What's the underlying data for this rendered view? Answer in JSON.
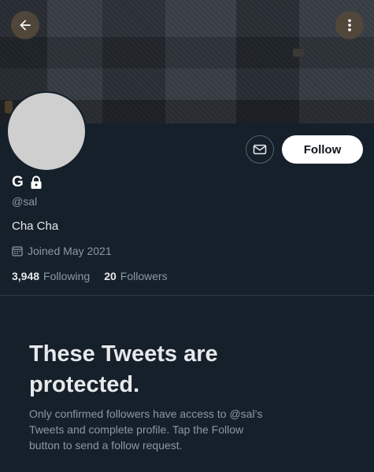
{
  "header": {
    "back_icon": "arrow-left-icon",
    "more_icon": "more-vertical-icon"
  },
  "profile": {
    "display_name": "G",
    "lock_icon": "lock-icon",
    "handle": "@sal",
    "bio": "Cha Cha",
    "joined": "Joined May 2021",
    "following_count": "3,948",
    "following_label": "Following",
    "followers_count": "20",
    "followers_label": "Followers"
  },
  "actions": {
    "message_icon": "envelope-icon",
    "follow_label": "Follow"
  },
  "protected": {
    "title": "These Tweets are protected.",
    "description": "Only confirmed followers have access to @sal’s Tweets and complete profile. Tap the Follow button to send a follow request."
  },
  "colors": {
    "background": "#15202b",
    "secondary_text": "#8b98a5",
    "follow_button_bg": "#ffffff"
  }
}
